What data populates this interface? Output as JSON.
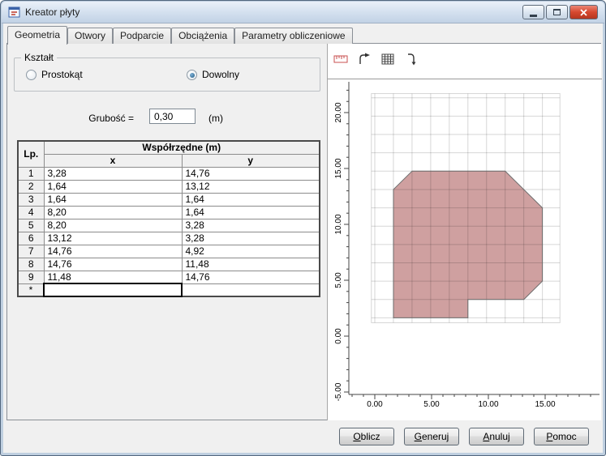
{
  "window": {
    "title": "Kreator płyty"
  },
  "tabs": [
    {
      "label": "Geometria",
      "active": true
    },
    {
      "label": "Otwory",
      "active": false
    },
    {
      "label": "Podparcie",
      "active": false
    },
    {
      "label": "Obciążenia",
      "active": false
    },
    {
      "label": "Parametry obliczeniowe",
      "active": false
    }
  ],
  "shape_group": {
    "title": "Kształt",
    "options": [
      {
        "label": "Prostokąt",
        "selected": false
      },
      {
        "label": "Dowolny",
        "selected": true
      }
    ]
  },
  "thickness": {
    "label": "Grubość =",
    "value": "0,30",
    "unit": "(m)"
  },
  "table": {
    "corner_header": "Lp.",
    "group_header": "Współrzędne (m)",
    "columns": [
      "x",
      "y"
    ],
    "rows": [
      {
        "lp": "1",
        "x": "3,28",
        "y": "14,76"
      },
      {
        "lp": "2",
        "x": "1,64",
        "y": "13,12"
      },
      {
        "lp": "3",
        "x": "1,64",
        "y": "1,64"
      },
      {
        "lp": "4",
        "x": "8,20",
        "y": "1,64"
      },
      {
        "lp": "5",
        "x": "8,20",
        "y": "3,28"
      },
      {
        "lp": "6",
        "x": "13,12",
        "y": "3,28"
      },
      {
        "lp": "7",
        "x": "14,76",
        "y": "4,92"
      },
      {
        "lp": "8",
        "x": "14,76",
        "y": "11,48"
      },
      {
        "lp": "9",
        "x": "11,48",
        "y": "14,76"
      },
      {
        "lp": "*",
        "x": "",
        "y": ""
      }
    ]
  },
  "toolbar": {
    "icons": [
      "dimension-ruler",
      "rotate-arrow",
      "grid",
      "hook-arrow"
    ]
  },
  "plot": {
    "x_ticks": [
      "0.00",
      "5.00",
      "10.00",
      "15.00"
    ],
    "y_ticks": [
      "20.00",
      "15.00",
      "10.00",
      "5.00",
      "0.00",
      "-5.00"
    ],
    "grid_module": 1.64,
    "polygon_fill": "#cfa0a0",
    "polygon_points": [
      [
        3.28,
        14.76
      ],
      [
        1.64,
        13.12
      ],
      [
        1.64,
        1.64
      ],
      [
        8.2,
        1.64
      ],
      [
        8.2,
        3.28
      ],
      [
        13.12,
        3.28
      ],
      [
        14.76,
        4.92
      ],
      [
        14.76,
        11.48
      ],
      [
        11.48,
        14.76
      ]
    ]
  },
  "buttons": [
    "Oblicz",
    "Generuj",
    "Anuluj",
    "Pomoc"
  ]
}
